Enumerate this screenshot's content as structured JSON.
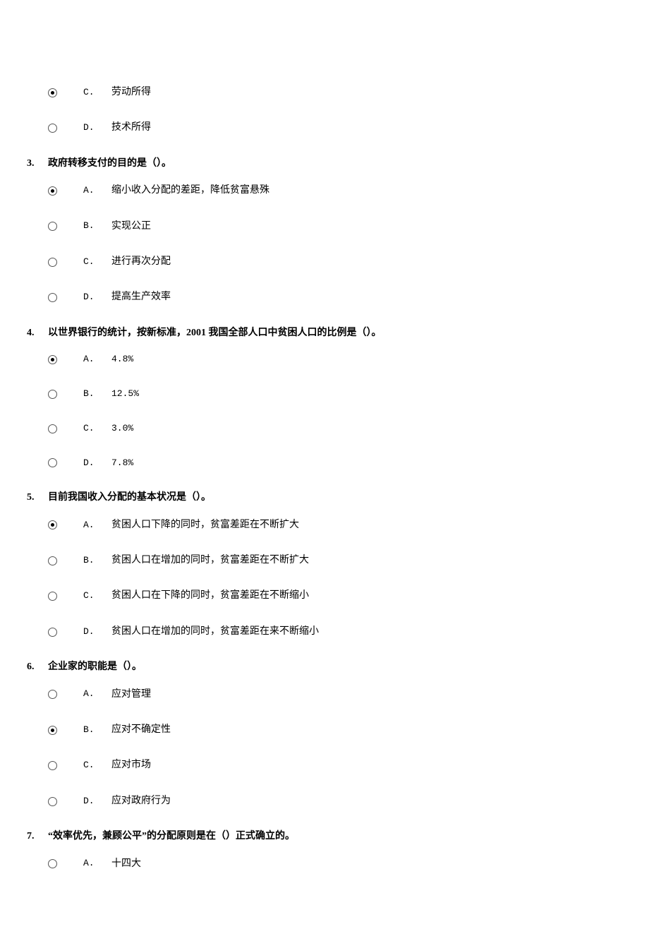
{
  "partial_question": {
    "options": [
      {
        "letter": "C.",
        "text": "劳动所得",
        "selected": true
      },
      {
        "letter": "D.",
        "text": "技术所得",
        "selected": false
      }
    ]
  },
  "questions": [
    {
      "number": "3.",
      "text": "政府转移支付的目的是（）。",
      "options": [
        {
          "letter": "A.",
          "text": "缩小收入分配的差距，降低贫富悬殊",
          "selected": true
        },
        {
          "letter": "B.",
          "text": "实现公正",
          "selected": false
        },
        {
          "letter": "C.",
          "text": "进行再次分配",
          "selected": false
        },
        {
          "letter": "D.",
          "text": "提高生产效率",
          "selected": false
        }
      ]
    },
    {
      "number": "4.",
      "text": "以世界银行的统计，按新标准，2001 我国全部人口中贫困人口的比例是（）。",
      "options": [
        {
          "letter": "A.",
          "text": "4.8%",
          "selected": true,
          "mono": true
        },
        {
          "letter": "B.",
          "text": "12.5%",
          "selected": false,
          "mono": true
        },
        {
          "letter": "C.",
          "text": "3.0%",
          "selected": false,
          "mono": true
        },
        {
          "letter": "D.",
          "text": "7.8%",
          "selected": false,
          "mono": true
        }
      ]
    },
    {
      "number": "5.",
      "text": "目前我国收入分配的基本状况是（）。",
      "options": [
        {
          "letter": "A.",
          "text": "贫困人口下降的同时，贫富差距在不断扩大",
          "selected": true
        },
        {
          "letter": "B.",
          "text": "贫困人口在增加的同时，贫富差距在不断扩大",
          "selected": false
        },
        {
          "letter": "C.",
          "text": "贫困人口在下降的同时，贫富差距在不断缩小",
          "selected": false
        },
        {
          "letter": "D.",
          "text": "贫困人口在增加的同时，贫富差距在来不断缩小",
          "selected": false
        }
      ]
    },
    {
      "number": "6.",
      "text": "企业家的职能是（）。",
      "options": [
        {
          "letter": "A.",
          "text": "应对管理",
          "selected": false
        },
        {
          "letter": "B.",
          "text": "应对不确定性",
          "selected": true
        },
        {
          "letter": "C.",
          "text": "应对市场",
          "selected": false
        },
        {
          "letter": "D.",
          "text": "应对政府行为",
          "selected": false
        }
      ]
    },
    {
      "number": "7.",
      "text": "“效率优先，兼顾公平”的分配原则是在（）正式确立的。",
      "options": [
        {
          "letter": "A.",
          "text": "十四大",
          "selected": false
        }
      ]
    }
  ]
}
